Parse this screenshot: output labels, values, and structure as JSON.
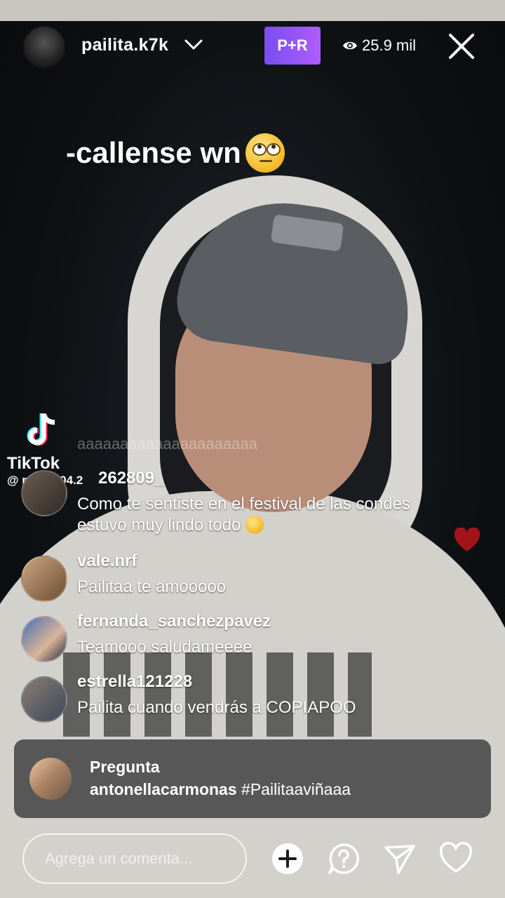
{
  "header": {
    "username": "pailita.k7k",
    "badge": "P+R",
    "viewer_count": "25.9 mil",
    "icons": [
      "chevron-down-icon",
      "eye-icon",
      "close-icon"
    ]
  },
  "caption": {
    "text": "-callense wn"
  },
  "watermark": {
    "name": "TikTok",
    "handle": "@ pailita.04.2"
  },
  "faded_comment": "aaaaaaaaaaaaaaaaaaaaa",
  "comments": [
    {
      "user": "262809_",
      "text": "Como te sentiste en el festival de las condes estuvo muy lindo todo"
    },
    {
      "user": "vale.nrf",
      "text": "Pailitaa te amooooo"
    },
    {
      "user": "fernanda_sanchezpavez",
      "text": "Teamooo saludameeee"
    },
    {
      "user": "estrella121228",
      "text": "Pailita cuando vendrás a COPIAPOO"
    }
  ],
  "question": {
    "title": "Pregunta",
    "user": "antonellacarmonas",
    "text": "#Pailitaaviñaaa"
  },
  "bottom_bar": {
    "placeholder": "Agrega un comenta...",
    "icons": [
      "add-icon",
      "question-icon",
      "send-icon",
      "heart-icon"
    ]
  },
  "colors": {
    "badge_gradient_start": "#7a4df0",
    "badge_gradient_end": "#b05cff",
    "heart": "#c0141c"
  }
}
